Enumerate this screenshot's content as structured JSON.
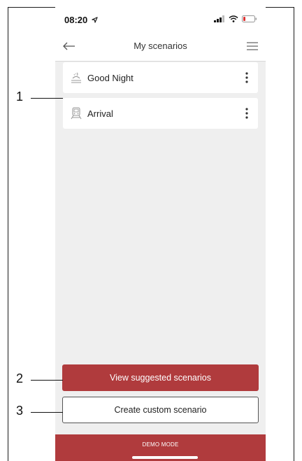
{
  "status_bar": {
    "time": "08:20"
  },
  "nav": {
    "title": "My scenarios"
  },
  "scenarios": [
    {
      "label": "Good Night",
      "icon": "night-icon"
    },
    {
      "label": "Arrival",
      "icon": "train-icon"
    }
  ],
  "buttons": {
    "view_suggested": "View suggested scenarios",
    "create_custom": "Create custom scenario"
  },
  "demo_mode": {
    "label": "DEMO MODE"
  },
  "callouts": [
    "1",
    "2",
    "3"
  ],
  "colors": {
    "accent": "#b03b3d",
    "background": "#efefef",
    "card": "#ffffff"
  }
}
